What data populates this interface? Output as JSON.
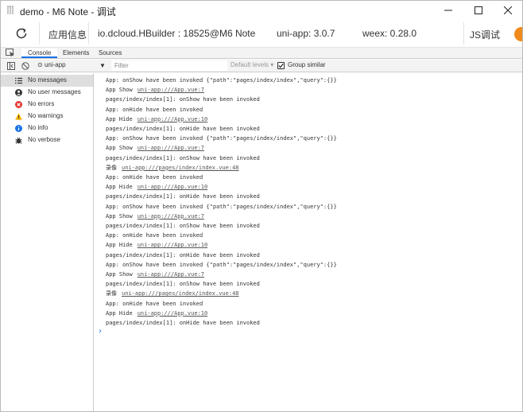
{
  "window": {
    "title": "demo - M6 Note - 调试"
  },
  "info_bar": {
    "app_info": "应用信息",
    "device": "io.dcloud.HBuilder : 18525@M6 Note",
    "uni_app_version": "uni-app: 3.0.7",
    "weex_version": "weex: 0.28.0",
    "js_debug": "JS调试"
  },
  "devtools": {
    "tabs": [
      {
        "label": "Console",
        "active": true
      },
      {
        "label": "Elements",
        "active": false
      },
      {
        "label": "Sources",
        "active": false
      }
    ]
  },
  "toolbar": {
    "context": "uni-app",
    "filter_placeholder": "Filter",
    "levels": "Default levels",
    "group_similar_label": "Group similar",
    "group_similar_checked": true
  },
  "sidebar": {
    "items": [
      {
        "label": "No messages",
        "icon": "list-icon",
        "selected": true
      },
      {
        "label": "No user messages",
        "icon": "user-icon",
        "selected": false
      },
      {
        "label": "No errors",
        "icon": "error-icon",
        "selected": false
      },
      {
        "label": "No warnings",
        "icon": "warning-icon",
        "selected": false
      },
      {
        "label": "No info",
        "icon": "info-icon",
        "selected": false
      },
      {
        "label": "No verbose",
        "icon": "bug-icon",
        "selected": false
      }
    ]
  },
  "logs": [
    {
      "text": "App: onShow have been invoked {\"path\":\"pages/index/index\",\"query\":{}}",
      "link": ""
    },
    {
      "text": "App Show",
      "link": "uni-app:///App.vue:7"
    },
    {
      "text": "pages/index/index[1]: onShow have been invoked",
      "link": ""
    },
    {
      "text": "App: onHide have been invoked",
      "link": ""
    },
    {
      "text": "App Hide",
      "link": "uni-app:///App.vue:10"
    },
    {
      "text": "pages/index/index[1]: onHide have been invoked",
      "link": ""
    },
    {
      "text": "App: onShow have been invoked {\"path\":\"pages/index/index\",\"query\":{}}",
      "link": ""
    },
    {
      "text": "App Show",
      "link": "uni-app:///App.vue:7"
    },
    {
      "text": "pages/index/index[1]: onShow have been invoked",
      "link": ""
    },
    {
      "text": "录像",
      "link": "uni-app:///pages/index/index.vue:48"
    },
    {
      "text": "App: onHide have been invoked",
      "link": ""
    },
    {
      "text": "App Hide",
      "link": "uni-app:///App.vue:10"
    },
    {
      "text": "pages/index/index[1]: onHide have been invoked",
      "link": ""
    },
    {
      "text": "App: onShow have been invoked {\"path\":\"pages/index/index\",\"query\":{}}",
      "link": ""
    },
    {
      "text": "App Show",
      "link": "uni-app:///App.vue:7"
    },
    {
      "text": "pages/index/index[1]: onShow have been invoked",
      "link": ""
    },
    {
      "text": "App: onHide have been invoked",
      "link": ""
    },
    {
      "text": "App Hide",
      "link": "uni-app:///App.vue:10"
    },
    {
      "text": "pages/index/index[1]: onHide have been invoked",
      "link": ""
    },
    {
      "text": "App: onShow have been invoked {\"path\":\"pages/index/index\",\"query\":{}}",
      "link": ""
    },
    {
      "text": "App Show",
      "link": "uni-app:///App.vue:7"
    },
    {
      "text": "pages/index/index[1]: onShow have been invoked",
      "link": ""
    },
    {
      "text": "录像",
      "link": "uni-app:///pages/index/index.vue:48"
    },
    {
      "text": "App: onHide have been invoked",
      "link": ""
    },
    {
      "text": "App Hide",
      "link": "uni-app:///App.vue:10"
    },
    {
      "text": "pages/index/index[1]: onHide have been invoked",
      "link": ""
    }
  ],
  "colors": {
    "accent": "#1a73e8",
    "error": "#e53935",
    "warning": "#f4b400",
    "info": "#1a73e8",
    "orange_button": "#f08a1c"
  }
}
